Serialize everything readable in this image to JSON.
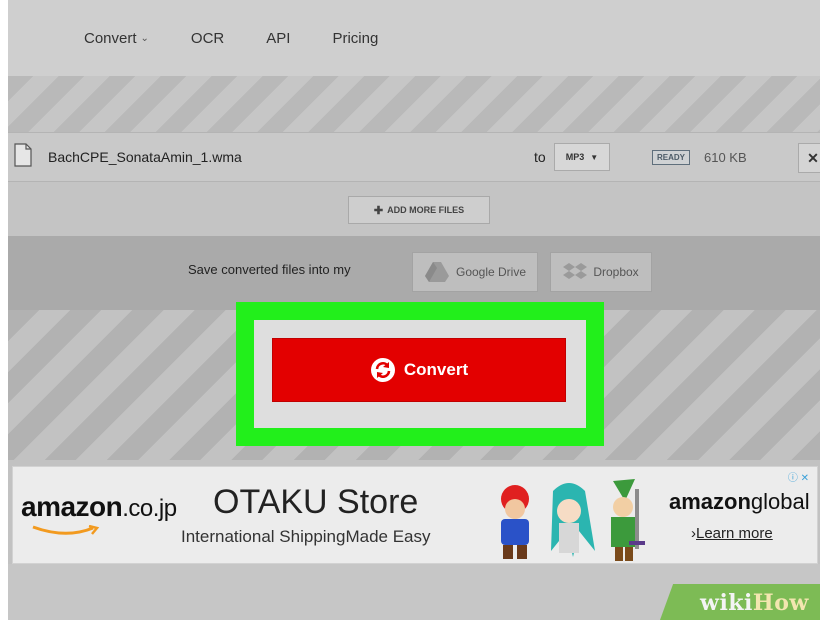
{
  "nav": {
    "items": [
      {
        "label": "Convert",
        "has_dropdown": true
      },
      {
        "label": "OCR"
      },
      {
        "label": "API"
      },
      {
        "label": "Pricing"
      }
    ]
  },
  "file": {
    "name": "BachCPE_SonataAmin_1.wma",
    "to_label": "to",
    "format": "MP3",
    "status": "READY",
    "size": "610 KB",
    "remove_label": "✕"
  },
  "add_more": {
    "label": "ADD MORE FILES"
  },
  "save": {
    "label": "Save converted files into my",
    "google_drive": "Google Drive",
    "dropbox": "Dropbox"
  },
  "convert": {
    "label": "Convert"
  },
  "ad": {
    "brand": "amazon",
    "brand_tld": ".co.jp",
    "title": "OTAKU Store",
    "subtitle": "International ShippingMade Easy",
    "global_brand": "amazon",
    "global_suffix": "global",
    "learn_more": "Learn more"
  },
  "watermark": {
    "part1": "wiki",
    "part2": "How"
  },
  "colors": {
    "convert_red": "#e30000",
    "highlight_green": "#22ef1b",
    "watermark_green": "#7dbb55"
  }
}
